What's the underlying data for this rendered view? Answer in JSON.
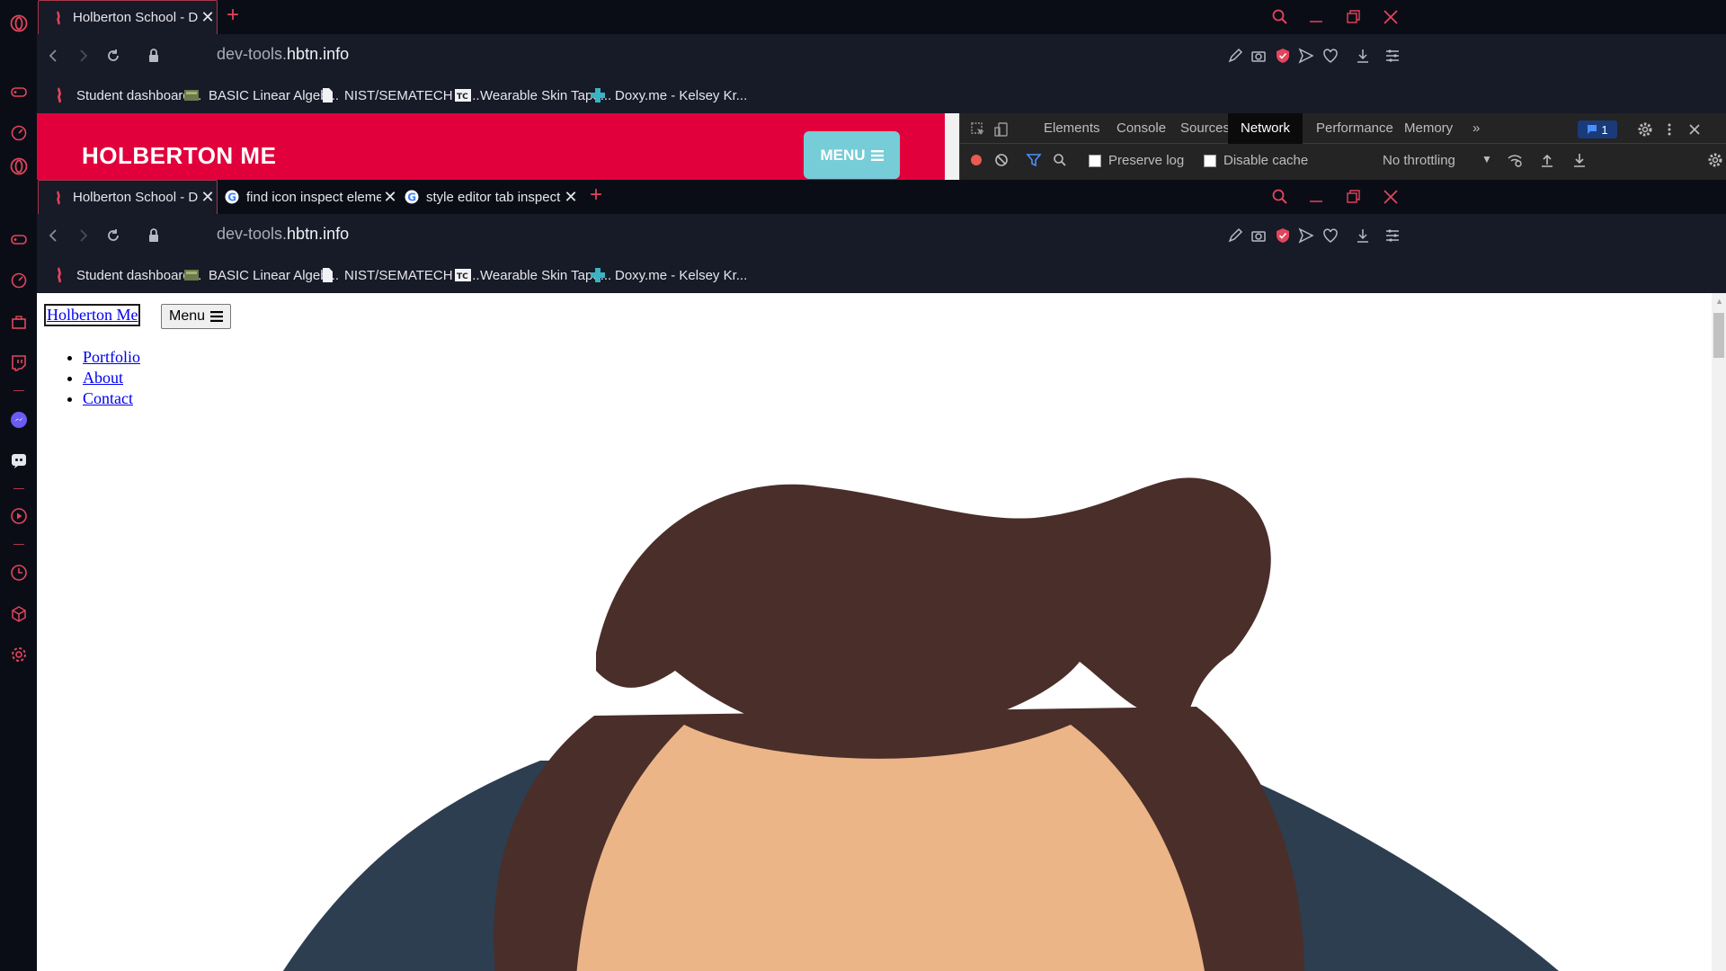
{
  "browser": {
    "tabs_top": [
      {
        "title": "Holberton School - Develop",
        "active": true
      }
    ],
    "tabs_bottom": [
      {
        "title": "Holberton School - Develop",
        "active": true
      },
      {
        "title": "find icon inspect element -",
        "active": false
      },
      {
        "title": "style editor tab inspect eler",
        "active": false
      }
    ],
    "new_tab_symbol": "+",
    "url_prefix": "dev-tools.",
    "url_domain": "hbtn.info",
    "bookmarks": [
      {
        "label": "Student dashboard...",
        "icon": "holberton-icon"
      },
      {
        "label": "BASIC Linear Algeb...",
        "icon": "image-icon"
      },
      {
        "label": "NIST/SEMATECH e-...",
        "icon": "document-icon"
      },
      {
        "label": "Wearable Skin Tape...",
        "icon": "tc-icon"
      },
      {
        "label": "Doxy.me - Kelsey Kr...",
        "icon": "plus-icon"
      }
    ]
  },
  "site": {
    "brand": "HOLBERTON ME",
    "menu_label": "MENU"
  },
  "devtools": {
    "tabs": [
      "Elements",
      "Console",
      "Sources",
      "Network",
      "Performance",
      "Memory"
    ],
    "selected_tab": "Network",
    "more": "»",
    "message_count": "1",
    "preserve_log": "Preserve log",
    "disable_cache": "Disable cache",
    "throttling": "No throttling"
  },
  "unstyled_page": {
    "brand_link": "Holberton Me",
    "menu_button": "Menu",
    "nav_links": [
      "Portfolio",
      "About",
      "Contact"
    ]
  },
  "colors": {
    "accent": "#e1003c",
    "menu_button": "#76cdd8",
    "hair": "#4a2e2a",
    "skin": "#ebb587",
    "shirt": "#2d3e50"
  }
}
